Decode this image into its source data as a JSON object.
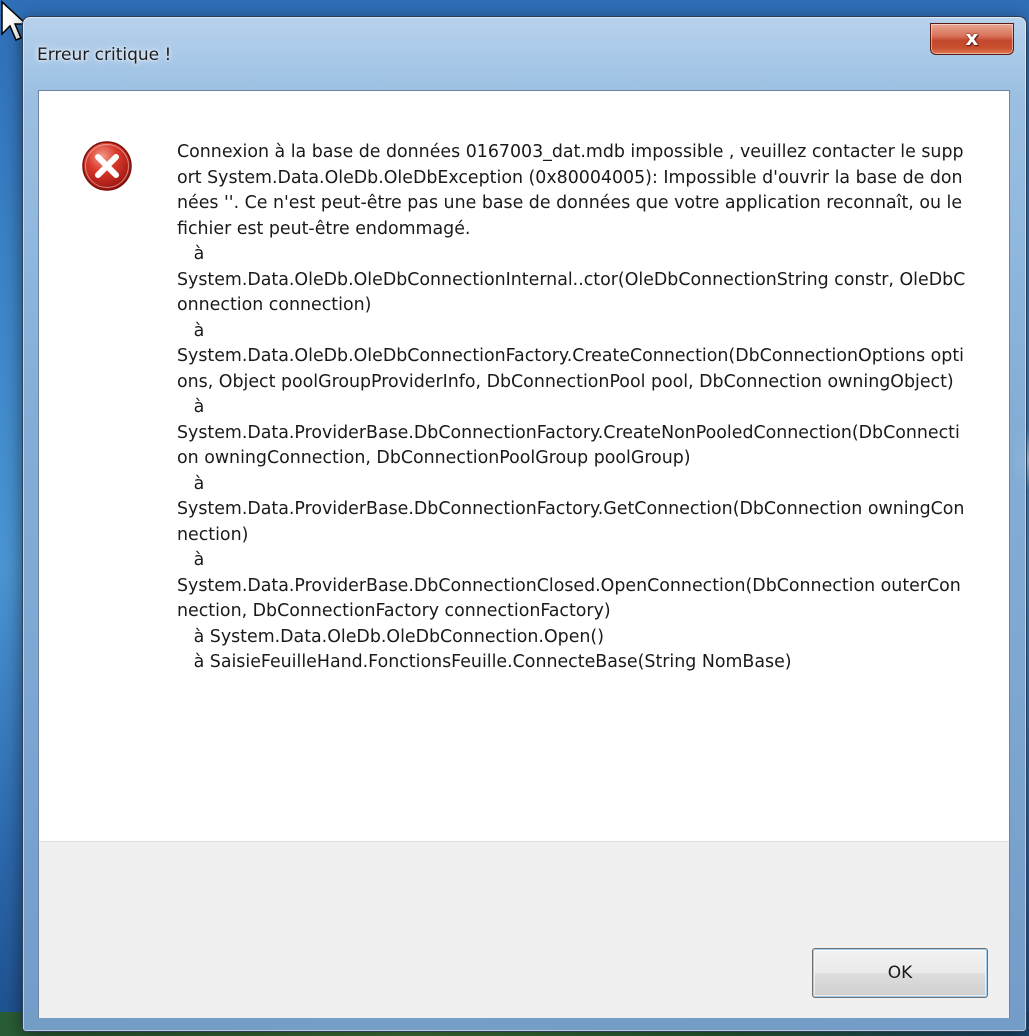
{
  "window": {
    "title": "Erreur critique !",
    "close_glyph": "x"
  },
  "dialog": {
    "icon": "error-icon",
    "icon_color": "#c8261e",
    "message": "Connexion à la base de données 0167003_dat.mdb impossible , veuillez contacter le support System.Data.OleDb.OleDbException (0x80004005): Impossible d'ouvrir la base de données ''. Ce n'est peut-être pas une base de données que votre application reconnaît, ou le fichier est peut-être endommagé.\n   à\nSystem.Data.OleDb.OleDbConnectionInternal..ctor(OleDbConnectionString constr, OleDbConnection connection)\n   à\nSystem.Data.OleDb.OleDbConnectionFactory.CreateConnection(DbConnectionOptions options, Object poolGroupProviderInfo, DbConnectionPool pool, DbConnection owningObject)\n   à\nSystem.Data.ProviderBase.DbConnectionFactory.CreateNonPooledConnection(DbConnection owningConnection, DbConnectionPoolGroup poolGroup)\n   à\nSystem.Data.ProviderBase.DbConnectionFactory.GetConnection(DbConnection owningConnection)\n   à\nSystem.Data.ProviderBase.DbConnectionClosed.OpenConnection(DbConnection outerConnection, DbConnectionFactory connectionFactory)\n   à System.Data.OleDb.OleDbConnection.Open()\n   à SaisieFeuilleHand.FonctionsFeuille.ConnecteBase(String NomBase)"
  },
  "buttons": {
    "ok_label": "OK"
  }
}
